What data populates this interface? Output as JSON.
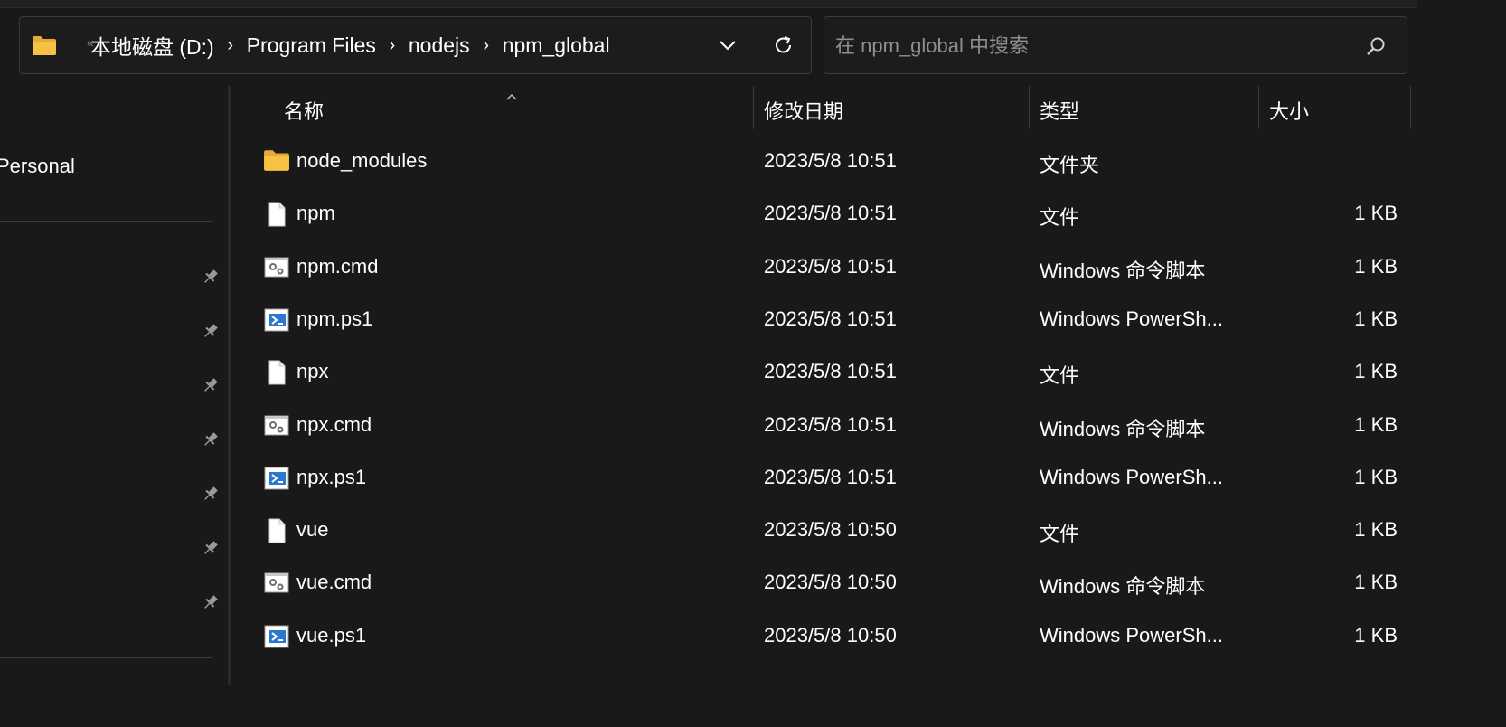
{
  "address_bar": {
    "overflow": "«",
    "breadcrumbs": [
      "本地磁盘 (D:)",
      "Program Files",
      "nodejs",
      "npm_global"
    ],
    "separator": "›"
  },
  "search": {
    "placeholder": "在 npm_global 中搜索",
    "value": ""
  },
  "sidebar": {
    "personal_label": "Personal",
    "pinned_count": 7
  },
  "columns": {
    "name": "名称",
    "modified": "修改日期",
    "type": "类型",
    "size": "大小",
    "sort": "name-ascending"
  },
  "files": [
    {
      "name": "node_modules",
      "modified": "2023/5/8 10:51",
      "type": "文件夹",
      "size": "",
      "icon": "folder-icon"
    },
    {
      "name": "npm",
      "modified": "2023/5/8 10:51",
      "type": "文件",
      "size": "1 KB",
      "icon": "file-icon"
    },
    {
      "name": "npm.cmd",
      "modified": "2023/5/8 10:51",
      "type": "Windows 命令脚本",
      "size": "1 KB",
      "icon": "cmd-script-icon"
    },
    {
      "name": "npm.ps1",
      "modified": "2023/5/8 10:51",
      "type": "Windows PowerSh...",
      "size": "1 KB",
      "icon": "powershell-script-icon"
    },
    {
      "name": "npx",
      "modified": "2023/5/8 10:51",
      "type": "文件",
      "size": "1 KB",
      "icon": "file-icon"
    },
    {
      "name": "npx.cmd",
      "modified": "2023/5/8 10:51",
      "type": "Windows 命令脚本",
      "size": "1 KB",
      "icon": "cmd-script-icon"
    },
    {
      "name": "npx.ps1",
      "modified": "2023/5/8 10:51",
      "type": "Windows PowerSh...",
      "size": "1 KB",
      "icon": "powershell-script-icon"
    },
    {
      "name": "vue",
      "modified": "2023/5/8 10:50",
      "type": "文件",
      "size": "1 KB",
      "icon": "file-icon"
    },
    {
      "name": "vue.cmd",
      "modified": "2023/5/8 10:50",
      "type": "Windows 命令脚本",
      "size": "1 KB",
      "icon": "cmd-script-icon"
    },
    {
      "name": "vue.ps1",
      "modified": "2023/5/8 10:50",
      "type": "Windows PowerSh...",
      "size": "1 KB",
      "icon": "powershell-script-icon"
    }
  ],
  "colors": {
    "background": "#191919",
    "folder": "#f5c242",
    "text": "#ffffff",
    "muted": "#8f8f8f"
  }
}
